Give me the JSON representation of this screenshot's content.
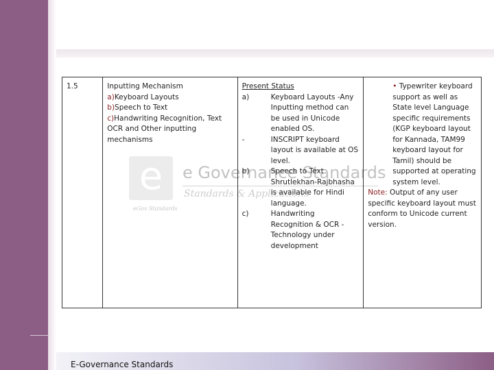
{
  "watermark": {
    "title": "e Governance Standards",
    "subtitle": "Standards & Applications",
    "logo_letter": "e",
    "logo_caption": "eGov Standards"
  },
  "table": {
    "row": {
      "number": "1.5",
      "mechanism": {
        "title": "Inputting Mechanism",
        "items": [
          {
            "marker": "a)",
            "text": "Keyboard Layouts"
          },
          {
            "marker": "b)",
            "text": "Speech to Text"
          },
          {
            "marker": "c)",
            "text": "Handwriting Recognition, Text OCR and Other inputting mechanisms"
          }
        ]
      },
      "status": {
        "heading": "Present Status",
        "items": [
          {
            "marker": "a)",
            "text": "Keyboard Layouts -Any Inputting method can be used in Unicode enabled OS."
          },
          {
            "marker": "-",
            "text": "INSCRIPT keyboard layout is available at OS level."
          },
          {
            "marker": "b)",
            "text": "Speech to Text Shrutlekhan-Rajbhasha is available for Hindi language."
          },
          {
            "marker": "c)",
            "text": "Handwriting Recognition & OCR - Technology under development"
          }
        ]
      },
      "remarks": {
        "bullet": "•",
        "bullet_text": "Typewriter keyboard support as well as State level Language specific requirements (KGP keyboard layout for Kannada, TAM99 keyboard layout for Tamil) should be supported at operating system level.",
        "note_label": "Note:",
        "note_text": "Output of any user specific keyboard layout must conform to Unicode current version."
      }
    }
  },
  "footer": {
    "text": "E-Governance Standards"
  },
  "colors": {
    "band": "#8c5e86",
    "accent_red": "#8b1c1c"
  }
}
